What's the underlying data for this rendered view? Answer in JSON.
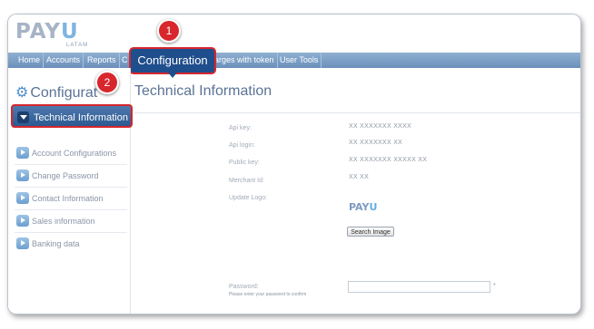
{
  "logo": {
    "text_main": "PAY",
    "text_u": "U",
    "sub": "LATAM"
  },
  "nav": {
    "items": [
      "Home",
      "Accounts",
      "Reports",
      "C",
      "arges with token",
      "User Tools"
    ],
    "active": "Configuration"
  },
  "callouts": [
    "1",
    "2"
  ],
  "sidebar": {
    "title": "Configurat",
    "active_item": "Technical Information",
    "items": [
      "Account Configurations",
      "Change Password",
      "Contact Information",
      "Sales information",
      "Banking data"
    ]
  },
  "main": {
    "title": "Technical Information",
    "fields": [
      {
        "label": "Api key:",
        "value": "XX XXXXXXX XXXX"
      },
      {
        "label": "Api login:",
        "value": "XX XXXXXXX XX"
      },
      {
        "label": "Public key:",
        "value": "XX XXXXXXX XXXXX XX"
      },
      {
        "label": "Merchant Id:",
        "value": "XX XX"
      },
      {
        "label": "Update Logo:",
        "value": ""
      }
    ],
    "mini_logo": {
      "main": "PAY",
      "u": "U"
    },
    "search_button": "Search Image",
    "password": {
      "label": "Password:",
      "hint": "Please enter your password to confirm",
      "required_mark": "*",
      "value": ""
    }
  },
  "colors": {
    "nav_bar": "#7a9dc6",
    "active_blue": "#1f4e8c",
    "highlight_red": "#d6262c",
    "heading_text": "#5b7396"
  }
}
